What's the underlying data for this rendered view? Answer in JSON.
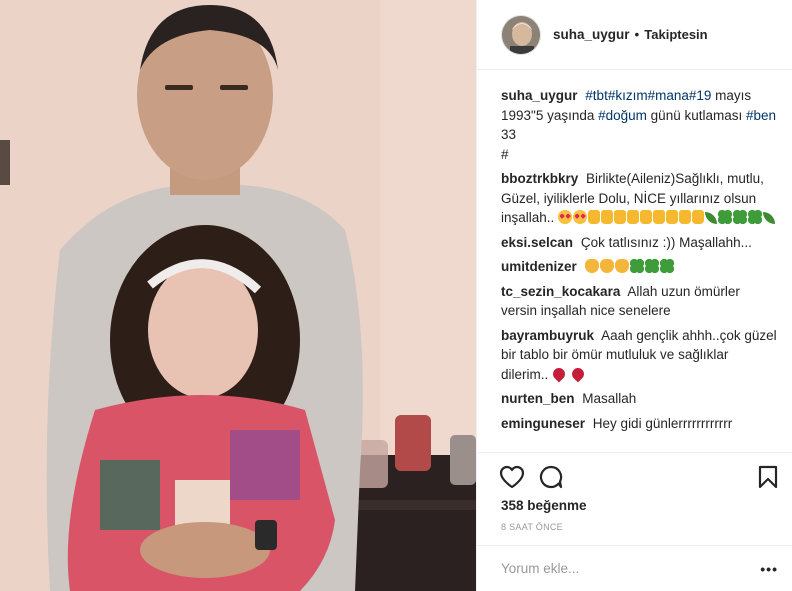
{
  "header": {
    "username": "suha_uygur",
    "separator": "•",
    "follow_status": "Takiptesin"
  },
  "caption": {
    "username": "suha_uygur",
    "tag1": "#tbt",
    "tag2": "#kızım",
    "tag3": "#mana",
    "tag4": "#19",
    "text1": " mayıs 1993\"5 yaşında ",
    "tag5": "#doğum",
    "text2": " günü kutlaması ",
    "tag6": "#ben",
    "text3": "33",
    "tag7": "#"
  },
  "comments": [
    {
      "user": "bboztrkbkry",
      "text": "Birlikte(Aileniz)Sağlıklı, mutlu, Güzel, iyiliklerle Dolu, NİCE yıllarınız olsun inşallah.."
    },
    {
      "user": "eksi.selcan",
      "text": "Çok tatlısınız :)) Maşallahh..."
    },
    {
      "user": "umitdenizer",
      "text": ""
    },
    {
      "user": "tc_sezin_kocakara",
      "text": "Allah uzun ömürler versin inşallah nice senelere"
    },
    {
      "user": "bayrambuyruk",
      "text": "Aaah gençlik ahhh..çok güzel bir tablo bir ömür mutluluk ve sağlıklar dilerim.."
    },
    {
      "user": "nurten_ben",
      "text": "Masallah"
    },
    {
      "user": "eminguneser",
      "text": "Hey gidi günlerrrrrrrrrrrr"
    }
  ],
  "icons": {
    "like": "heart-outline-icon",
    "comment": "comment-bubble-icon",
    "save": "bookmark-icon"
  },
  "likes": "358 beğenme",
  "time_ago": "8 SAAT ÖNCE",
  "add_comment": {
    "placeholder": "Yorum ekle..."
  },
  "more_label": "•••",
  "colors": {
    "hashtag": "#003569",
    "border": "#efefef",
    "muted": "#999999"
  }
}
